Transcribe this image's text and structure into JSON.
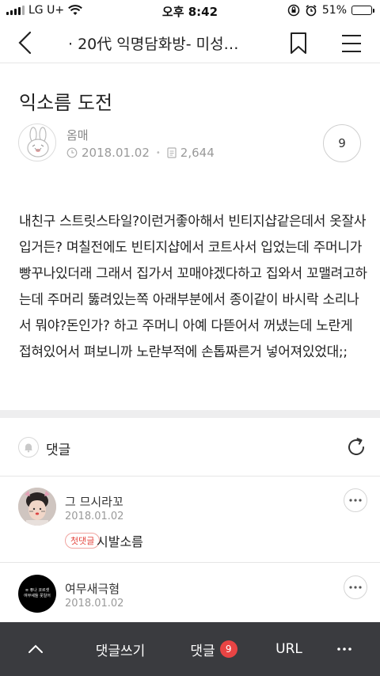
{
  "status_bar": {
    "carrier": "LG U+",
    "time": "오후 8:42",
    "battery": "51%",
    "battery_level": 0.51
  },
  "nav": {
    "title": "· 20代 익명담화방- 미성…"
  },
  "post": {
    "title": "익소름 도전",
    "author": "옴매",
    "date": "2018.01.02",
    "views": "2,644",
    "comment_count": "9",
    "body": "내친구 스트릿스타일?이런거좋아해서 빈티지샵같은데서 옷잘사입거든? 며칠전에도 빈티지샵에서 코트사서 입었는데 주머니가 빵꾸나있더래 그래서 집가서 꼬매야겠다하고 집와서 꼬맬려고하는데 주머리 뚫려있는쪽 아래부분에서 종이같이 바시락 소리나서 뭐야?돈인가? 하고 주머니 아예 다뜯어서 꺼냈는데 노란게 접혀있어서 펴보니까 노란부적에 손톱짜른거 넣어져있었대;;"
  },
  "comments_section": {
    "label": "댓글"
  },
  "comments": [
    {
      "name": "그 므시라꼬",
      "date": "2018.01.02",
      "badge": "첫댓글",
      "text": "시발소름"
    },
    {
      "name": "여무새극혐",
      "date": "2018.01.02",
      "avatar_text": [
        "≡ 퓨나 코르셋",
        "여무새들 못일어"
      ]
    }
  ],
  "bottom_bar": {
    "write_comment": "댓글쓰기",
    "comments": "댓글",
    "comments_badge": "9",
    "url": "URL"
  },
  "colors": {
    "accent_red": "#e84444",
    "bottom_bar": "#3a3b3f",
    "battery": "#f2c200"
  }
}
